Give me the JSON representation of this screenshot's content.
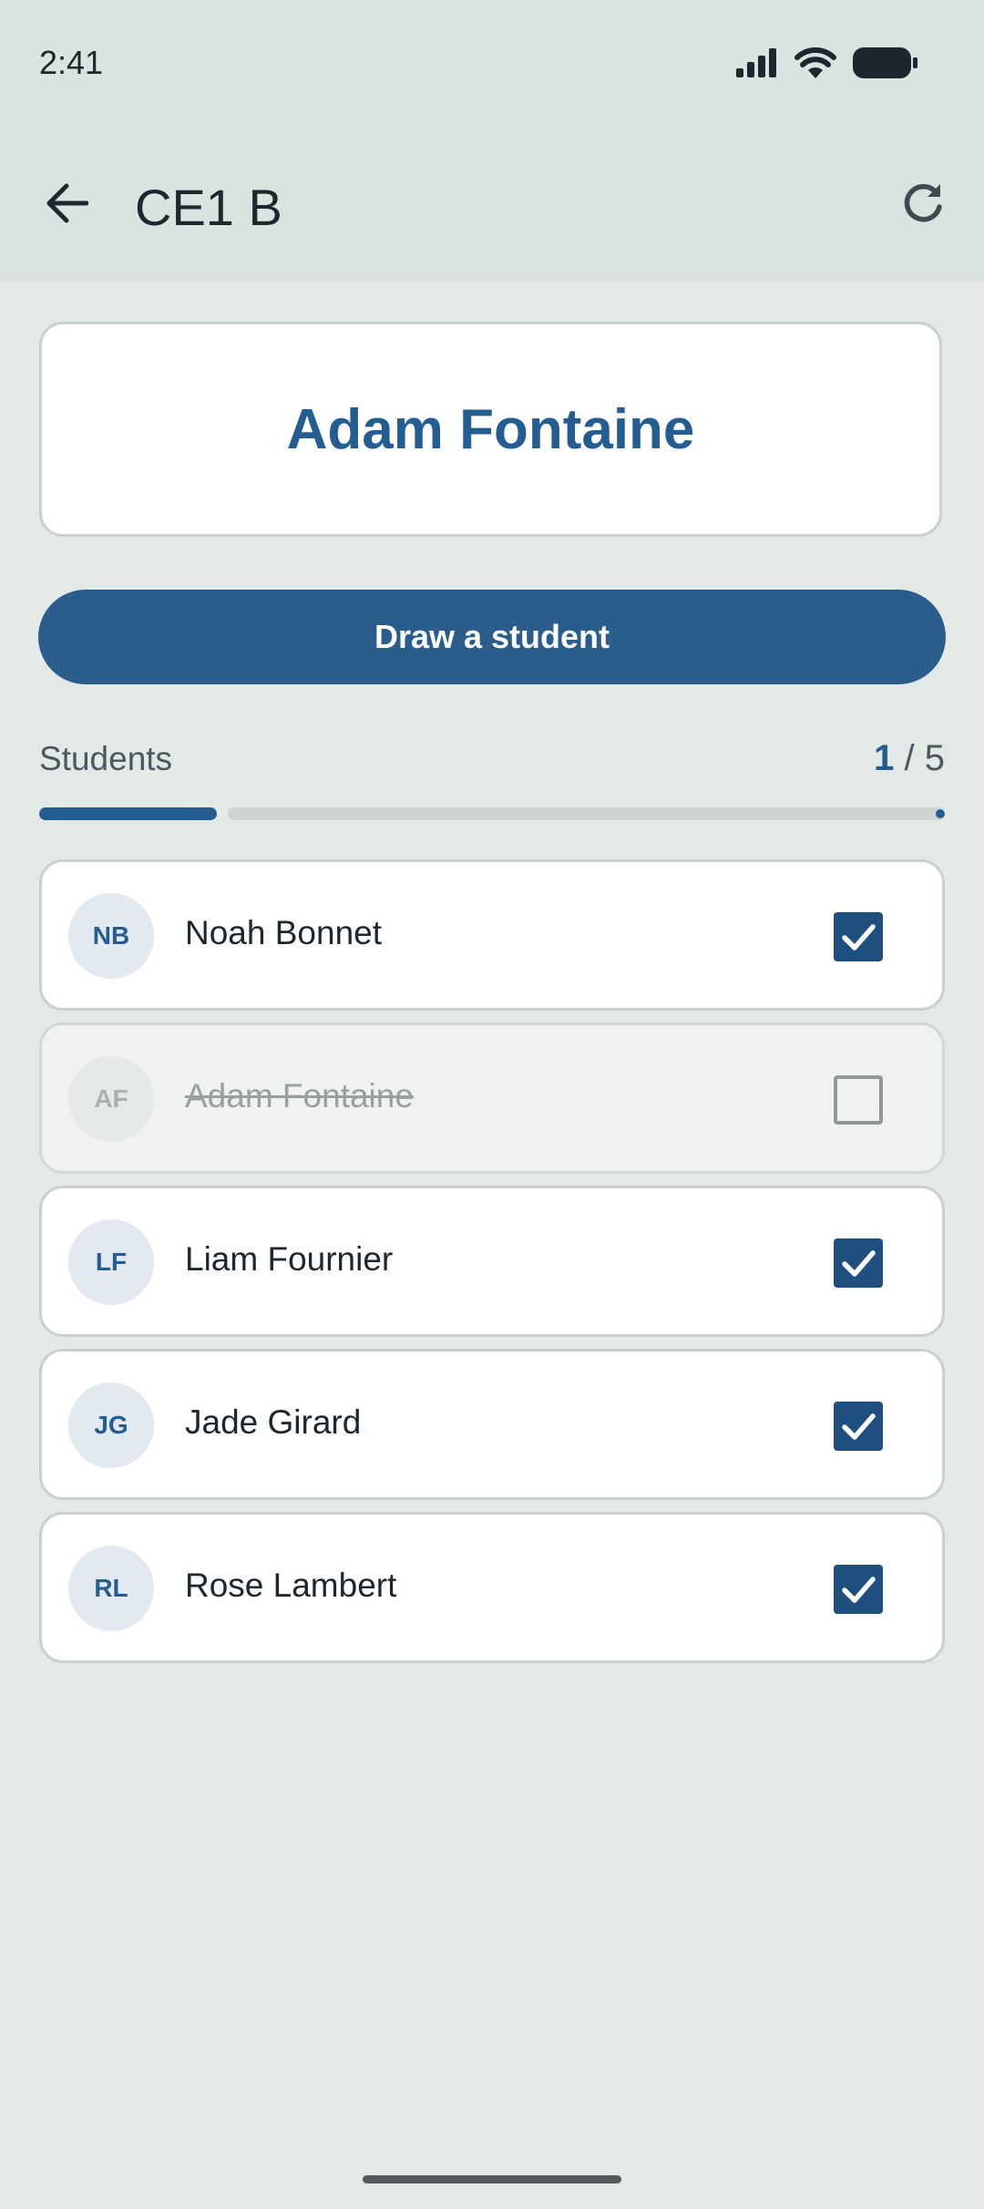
{
  "status_bar": {
    "time": "2:41"
  },
  "app_bar": {
    "title": "CE1 B"
  },
  "picked": {
    "name": "Adam Fontaine"
  },
  "draw_button": {
    "label": "Draw a student"
  },
  "progress": {
    "label": "Students",
    "current": "1",
    "separator": "/",
    "total": "5",
    "fraction": 0.2
  },
  "students": [
    {
      "initials": "NB",
      "name": "Noah Bonnet",
      "checked": true
    },
    {
      "initials": "AF",
      "name": "Adam Fontaine",
      "checked": false
    },
    {
      "initials": "LF",
      "name": "Liam Fournier",
      "checked": true
    },
    {
      "initials": "JG",
      "name": "Jade Girard",
      "checked": true
    },
    {
      "initials": "RL",
      "name": "Rose Lambert",
      "checked": true
    }
  ],
  "colors": {
    "accent": "#245d91",
    "button": "#2a5d8c",
    "background": "#e3eae5",
    "app_bar": "#dbe3de"
  },
  "icons": [
    "signal-icon",
    "wifi-icon",
    "battery-icon",
    "back-arrow-icon",
    "refresh-icon",
    "check-icon"
  ]
}
